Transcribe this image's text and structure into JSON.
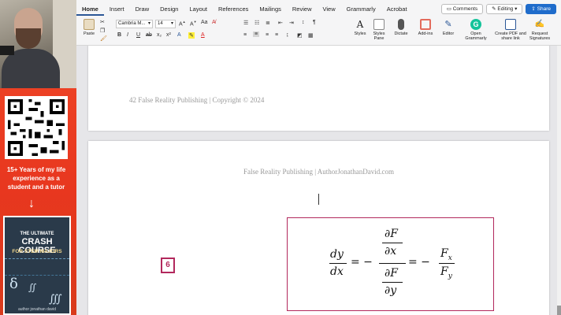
{
  "promo": {
    "tagline": "15+ Years of my life experience as a student and a tutor",
    "arrow": "↓",
    "book": {
      "line1": "THE ULTIMATE",
      "line2": "CRASH COURSE",
      "line3": "FOR STEM MAJORS",
      "author": "author jonathan david",
      "symbols": [
        "δ",
        "∬",
        "∭"
      ]
    }
  },
  "ribbon": {
    "tabs": [
      "Home",
      "Insert",
      "Draw",
      "Design",
      "Layout",
      "References",
      "Mailings",
      "Review",
      "View",
      "Grammarly",
      "Acrobat"
    ],
    "comments": "Comments",
    "editing": "Editing",
    "share": "Share",
    "paste": "Paste",
    "font_name": "Cambria M...",
    "font_size": "14",
    "styles": "Styles",
    "styles_pane": "Styles Pane",
    "dictate": "Dictate",
    "addins": "Add-ins",
    "editor": "Editor",
    "grammarly": "Open Grammarly",
    "create_pdf": "Create PDF and share link",
    "request_sig": "Request Signatures"
  },
  "document": {
    "page1_footer": "42  False Reality Publishing | Copyright © 2024",
    "page2_header": "False Reality Publishing | AuthorJonathanDavid.com",
    "equation_number": "6",
    "equation": {
      "lhs_num": "dy",
      "lhs_den": "dx",
      "eq1": "= −",
      "inner_num_num": "∂F",
      "inner_num_den": "∂x",
      "inner_den_num": "∂F",
      "inner_den_den": "∂y",
      "eq2": "= −",
      "rhs_num": "F",
      "rhs_num_sub": "x",
      "rhs_den": "F",
      "rhs_den_sub": "y"
    }
  },
  "colors": {
    "accent": "#b2285c",
    "promo_bg": "#f04a28",
    "share_blue": "#1f6ccb"
  }
}
